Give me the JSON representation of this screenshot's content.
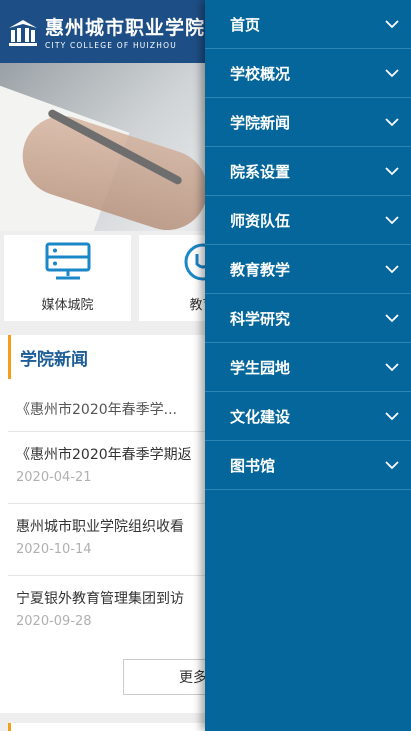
{
  "header": {
    "title_cn": "惠州城市职业学院",
    "title_en": "CITY COLLEGE OF HUIZHOU"
  },
  "quick_links": [
    {
      "label": "媒体城院",
      "icon": "monitor-icon"
    },
    {
      "label": "教育",
      "icon": "circle-icon"
    }
  ],
  "news": {
    "title": "学院新闻",
    "top_headline": "《惠州市2020年春季学...",
    "items": [
      {
        "title": "《惠州市2020年春季学期返",
        "date": "2020-04-21"
      },
      {
        "title": "惠州城市职业学院组织收看",
        "date": "2020-10-14"
      },
      {
        "title": "宁夏银外教育管理集团到访",
        "date": "2020-09-28"
      }
    ],
    "more_label": "更多"
  },
  "menu": {
    "items": [
      {
        "label": "首页"
      },
      {
        "label": "学校概况"
      },
      {
        "label": "学院新闻"
      },
      {
        "label": "院系设置"
      },
      {
        "label": "师资队伍"
      },
      {
        "label": "教育教学"
      },
      {
        "label": "科学研究"
      },
      {
        "label": "学生园地"
      },
      {
        "label": "文化建设"
      },
      {
        "label": "图书馆"
      }
    ]
  },
  "colors": {
    "header_bg": "#1d4f86",
    "menu_bg": "#04669a",
    "accent": "#f2a01b",
    "news_title": "#1d5e98"
  }
}
